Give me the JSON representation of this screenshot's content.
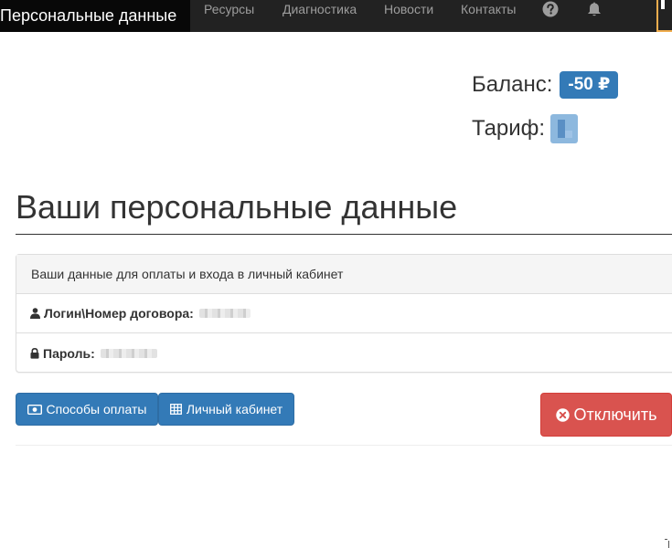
{
  "navbar": {
    "brand": "Персональные данные",
    "links": [
      "Ресурсы",
      "Диагностика",
      "Новости",
      "Контакты"
    ],
    "icons": [
      "help-icon",
      "bell-icon"
    ]
  },
  "account": {
    "balance_label": "Баланс:",
    "balance_value": "-50 ₽",
    "tariff_label": "Тариф:"
  },
  "page": {
    "title": "Ваши персональные данные"
  },
  "panel": {
    "heading": "Ваши данные для оплаты и входа в личный кабинет",
    "login_label": "Логин\\Номер договора:",
    "password_label": "Пароль:"
  },
  "buttons": {
    "payment_methods": "Способы оплаты",
    "personal_cabinet": "Личный кабинет",
    "disconnect": "Отключить"
  },
  "colors": {
    "navbar": "#222222",
    "primary": "#337ab7",
    "danger": "#d9534f"
  }
}
